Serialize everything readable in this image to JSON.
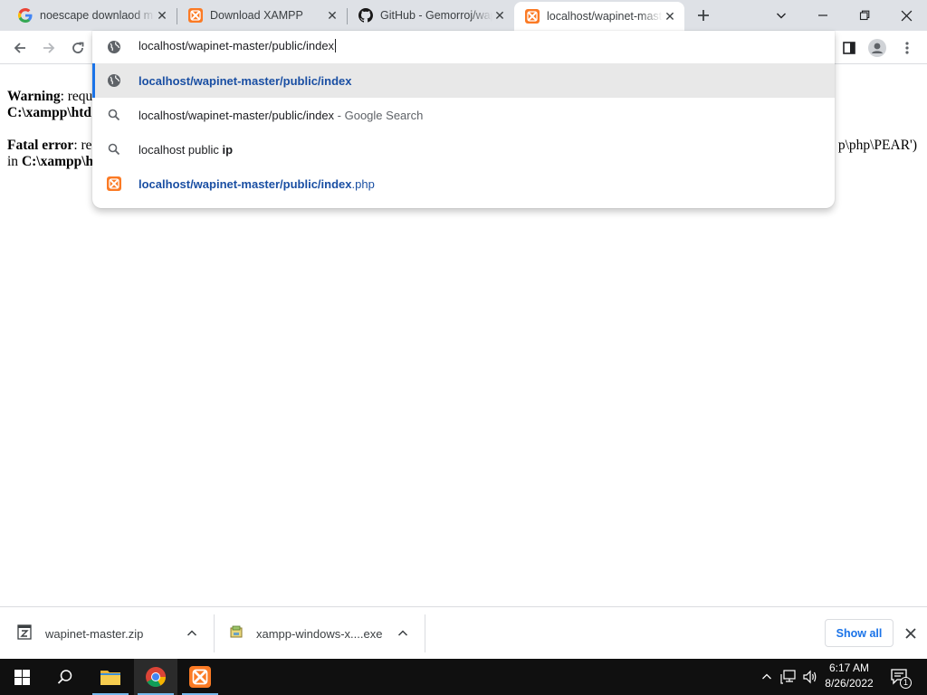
{
  "tabs": [
    {
      "title": "noescape downlaod m",
      "icon": "google-icon"
    },
    {
      "title": "Download XAMPP",
      "icon": "xampp-icon"
    },
    {
      "title": "GitHub - Gemorroj/wapinet",
      "icon": "github-icon"
    },
    {
      "title": "localhost/wapinet-master/public/index",
      "icon": "xampp-icon",
      "active": true
    }
  ],
  "omnibox": {
    "input": "localhost/wapinet-master/public/index",
    "suggestions": [
      {
        "bold": "localhost/wapinet-master/public/index",
        "rest": "",
        "suffix": "",
        "icon": "globe-icon"
      },
      {
        "bold": "",
        "rest": "localhost/wapinet-master/public/index",
        "suffix": " - Google Search",
        "icon": "search-icon"
      },
      {
        "bold": "",
        "rest": "localhost public ",
        "suffix": "ip",
        "icon": "search-icon"
      },
      {
        "bold": "localhost/wapinet-master/public/index",
        "rest": ".php",
        "suffix": "",
        "icon": "xampp-icon"
      }
    ]
  },
  "page": {
    "warning_label": "Warning",
    "warning_text": ": requ",
    "warning_path": "C:\\xampp\\htd",
    "fatal_label": "Fatal error",
    "fatal_text": ": re",
    "fatal_tail": "p\\php\\PEAR')",
    "fatal_in": "in ",
    "fatal_path": "C:\\xampp\\h"
  },
  "downloads": {
    "items": [
      {
        "name": "wapinet-master.zip",
        "icon": "zip-file-icon"
      },
      {
        "name": "xampp-windows-x....exe",
        "icon": "installer-file-icon"
      }
    ],
    "show_all": "Show all"
  },
  "taskbar": {
    "time": "6:17 AM",
    "date": "8/26/2022",
    "notification_count": "1"
  },
  "colors": {
    "accent": "#1a73e8",
    "xampp": "#fb7a24",
    "taskbar": "#101010"
  }
}
